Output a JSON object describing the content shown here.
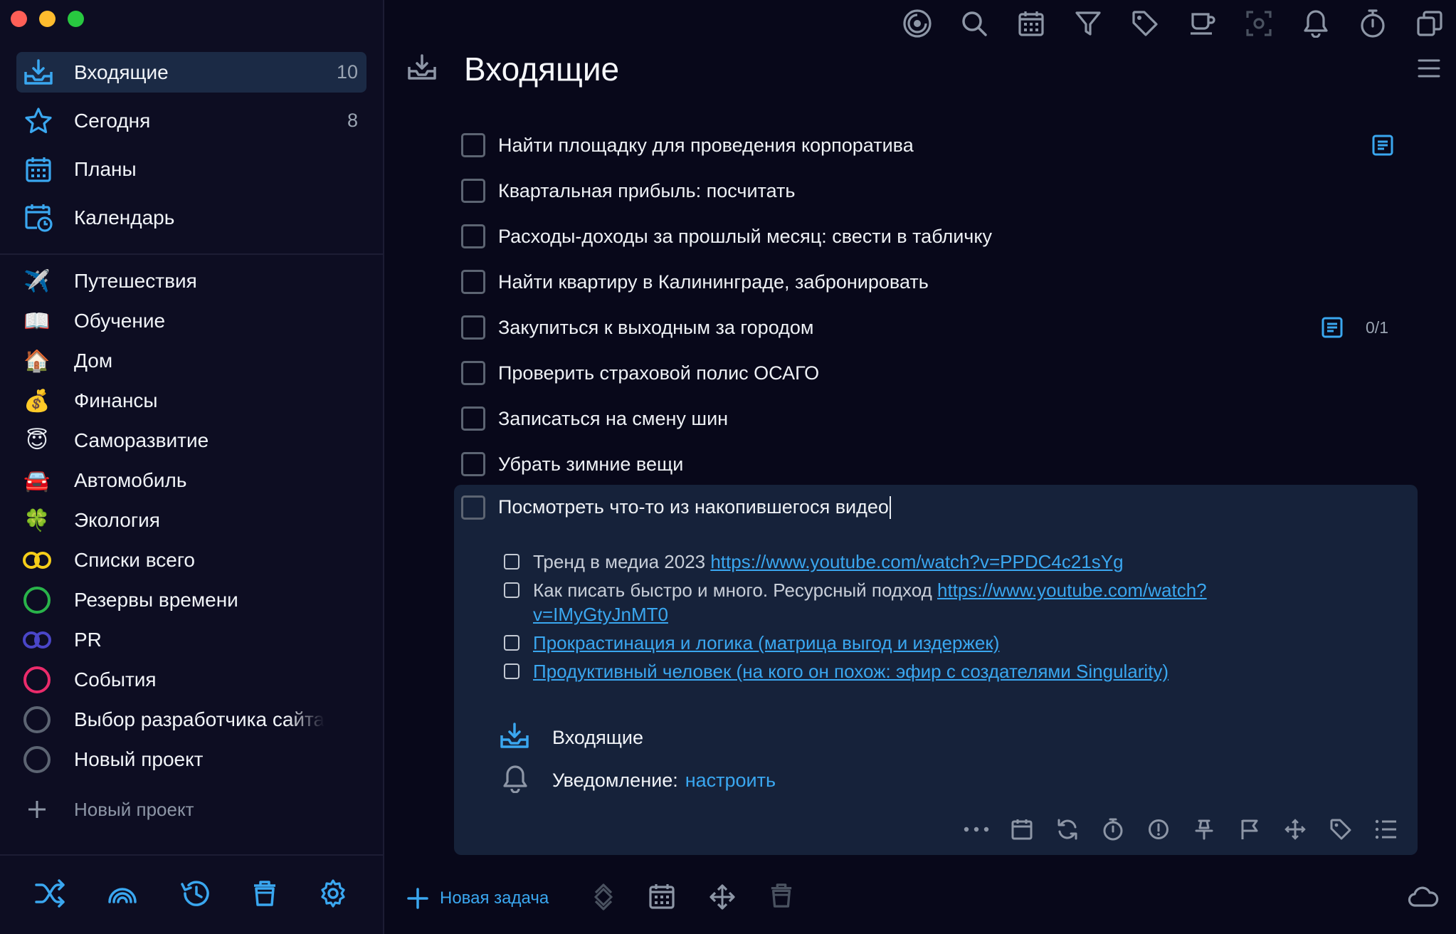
{
  "sidebar": {
    "main_nav": [
      {
        "label": "Входящие",
        "count": "10",
        "icon": "inbox-icon"
      },
      {
        "label": "Сегодня",
        "count": "8",
        "icon": "star-icon"
      },
      {
        "label": "Планы",
        "count": "",
        "icon": "calendar-grid-icon"
      },
      {
        "label": "Календарь",
        "count": "",
        "icon": "calendar-clock-icon"
      }
    ],
    "projects": [
      {
        "label": "Путешествия",
        "icon": "✈️"
      },
      {
        "label": "Обучение",
        "icon": "📖"
      },
      {
        "label": "Дом",
        "icon": "🏠"
      },
      {
        "label": "Финансы",
        "icon": "💰"
      },
      {
        "label": "Саморазвитие",
        "icon": "😇"
      },
      {
        "label": "Автомобиль",
        "icon": "🚘"
      },
      {
        "label": "Экология",
        "icon": "🍀"
      },
      {
        "label": "Списки всего",
        "icon": "double-ring-yellow"
      },
      {
        "label": "Резервы времени",
        "icon": "ring-green"
      },
      {
        "label": "PR",
        "icon": "double-ring-purple"
      },
      {
        "label": "События",
        "icon": "ring-pink"
      },
      {
        "label": "Выбор разработчика сайта",
        "icon": "ring-gray"
      },
      {
        "label": "Новый проект",
        "icon": "ring-gray"
      }
    ],
    "new_project_label": "Новый проект",
    "colors": {
      "yellow": "#f5cd19",
      "green": "#29b34a",
      "purple": "#4a46c8",
      "pink": "#ea2b6b",
      "gray": "#5c6472"
    }
  },
  "main": {
    "title": "Входящие",
    "tasks": [
      {
        "title": "Найти площадку для проведения корпоратива",
        "has_note": true,
        "count": ""
      },
      {
        "title": "Квартальная прибыль: посчитать",
        "has_note": false,
        "count": ""
      },
      {
        "title": "Расходы-доходы за прошлый месяц: свести в табличку",
        "has_note": false,
        "count": ""
      },
      {
        "title": "Найти квартиру в Калининграде, забронировать",
        "has_note": false,
        "count": ""
      },
      {
        "title": "Закупиться к выходным за городом",
        "has_note": true,
        "count": "0/1"
      },
      {
        "title": "Проверить страховой полис ОСАГО",
        "has_note": false,
        "count": ""
      },
      {
        "title": "Записаться на смену шин",
        "has_note": false,
        "count": ""
      },
      {
        "title": "Убрать зимние вещи",
        "has_note": false,
        "count": ""
      }
    ],
    "expanded_task": {
      "title": "Посмотреть что-то из накопившегося видео",
      "subtasks": [
        {
          "text": "Тренд в медиа 2023 ",
          "link": "https://www.youtube.com/watch?v=PPDC4c21sYg",
          "link2": ""
        },
        {
          "text": "Как писать быстро и много. Ресурсный подход ",
          "link": "https://www.youtube.com/watch?",
          "link2": "v=IMyGtyJnMT0"
        },
        {
          "text": "",
          "link": "Прокрастинация и логика (матрица выгод и издержек)",
          "link2": ""
        },
        {
          "text": "",
          "link": "Продуктивный человек (на кого он похож: эфир с создателями Singularity)",
          "link2": ""
        }
      ],
      "project_label": "Входящие",
      "reminder_label": "Уведомление:",
      "reminder_link": "настроить"
    },
    "new_task_label": "Новая задача"
  },
  "accent": "#3aa7f0"
}
